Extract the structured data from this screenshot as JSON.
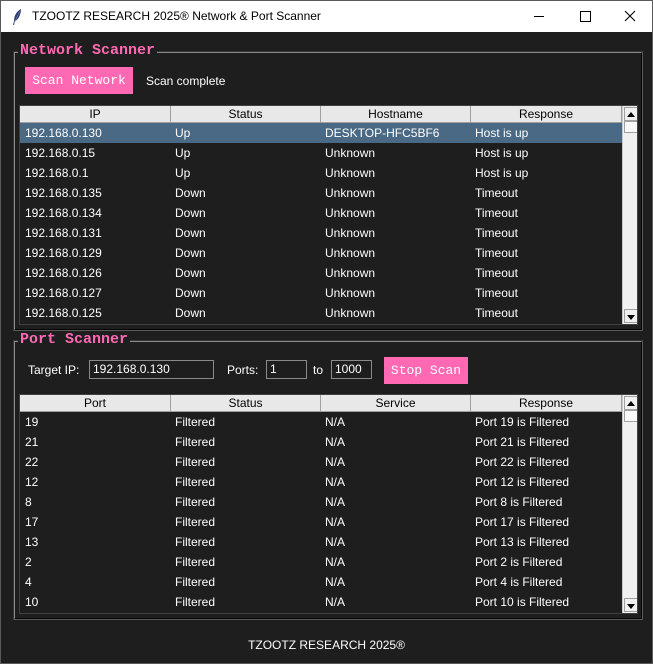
{
  "window": {
    "title": "TZOOTZ RESEARCH 2025®  Network & Port Scanner"
  },
  "network_scanner": {
    "frame_title": "Network Scanner",
    "scan_button": "Scan Network",
    "status": "Scan complete",
    "columns": [
      "IP",
      "Status",
      "Hostname",
      "Response"
    ],
    "selected_row": 0,
    "rows": [
      [
        "192.168.0.130",
        "Up",
        "DESKTOP-HFC5BF6",
        "Host is up"
      ],
      [
        "192.168.0.15",
        "Up",
        "Unknown",
        "Host is up"
      ],
      [
        "192.168.0.1",
        "Up",
        "Unknown",
        "Host is up"
      ],
      [
        "192.168.0.135",
        "Down",
        "Unknown",
        "Timeout"
      ],
      [
        "192.168.0.134",
        "Down",
        "Unknown",
        "Timeout"
      ],
      [
        "192.168.0.131",
        "Down",
        "Unknown",
        "Timeout"
      ],
      [
        "192.168.0.129",
        "Down",
        "Unknown",
        "Timeout"
      ],
      [
        "192.168.0.126",
        "Down",
        "Unknown",
        "Timeout"
      ],
      [
        "192.168.0.127",
        "Down",
        "Unknown",
        "Timeout"
      ],
      [
        "192.168.0.125",
        "Down",
        "Unknown",
        "Timeout"
      ]
    ]
  },
  "port_scanner": {
    "frame_title": "Port Scanner",
    "target_label": "Target IP:",
    "target_value": "192.168.0.130",
    "ports_label": "Ports:",
    "port_from": "1",
    "to_label": "to",
    "port_to": "1000",
    "stop_button": "Stop Scan",
    "columns": [
      "Port",
      "Status",
      "Service",
      "Response"
    ],
    "rows": [
      [
        "19",
        "Filtered",
        "N/A",
        "Port 19 is Filtered"
      ],
      [
        "21",
        "Filtered",
        "N/A",
        "Port 21 is Filtered"
      ],
      [
        "22",
        "Filtered",
        "N/A",
        "Port 22 is Filtered"
      ],
      [
        "12",
        "Filtered",
        "N/A",
        "Port 12 is Filtered"
      ],
      [
        "8",
        "Filtered",
        "N/A",
        "Port 8 is Filtered"
      ],
      [
        "17",
        "Filtered",
        "N/A",
        "Port 17 is Filtered"
      ],
      [
        "13",
        "Filtered",
        "N/A",
        "Port 13 is Filtered"
      ],
      [
        "2",
        "Filtered",
        "N/A",
        "Port 2 is Filtered"
      ],
      [
        "4",
        "Filtered",
        "N/A",
        "Port 4 is Filtered"
      ],
      [
        "10",
        "Filtered",
        "N/A",
        "Port 10 is Filtered"
      ]
    ]
  },
  "footer": "TZOOTZ RESEARCH 2025®",
  "colors": {
    "accent": "#ff69b4",
    "background": "#1e1e1e",
    "selection": "#4a6984"
  }
}
